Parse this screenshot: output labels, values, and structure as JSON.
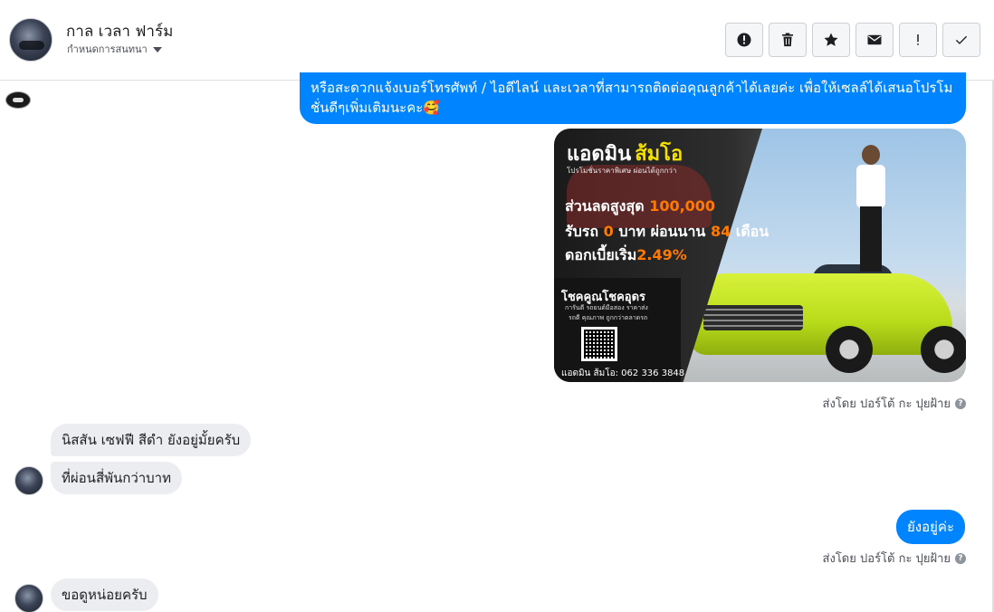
{
  "header": {
    "name": "กาล เวลา ฟาร์ม",
    "subtitle": "กำหนดการสนทนา"
  },
  "toolbar": {
    "buttons": [
      {
        "icon": "alert-circle-icon"
      },
      {
        "icon": "trash-icon"
      },
      {
        "icon": "star-icon"
      },
      {
        "icon": "envelope-icon"
      },
      {
        "icon": "exclamation-icon",
        "label": "!"
      },
      {
        "icon": "check-icon"
      }
    ]
  },
  "messages": {
    "long_outgoing": "หรือสะดวกแจ้งเบอร์โทรศัพท์ / ไอดีไลน์ และเวลาที่สามารถติดต่อคุณลูกค้าได้เลยค่ะ เพื่อให้เซลล์ได้เสนอโปรโมชั่นดีๆเพิ่มเติมนะคะ🥰",
    "ad": {
      "title_a": "แอดมิน",
      "title_b": "ส้มโอ",
      "tag": "โปรโมชั่นราคาพิเศษ ผ่อนได้ถูกกว่า",
      "line1_pre": "ส่วนลดสูงสุด ",
      "line1_hl": "100,000",
      "line2_pre": "รับรถ ",
      "line2_hl1": "0",
      "line2_mid": " บาท ผ่อนนาน ",
      "line2_hl2": "84",
      "line2_post": " เดือน",
      "line3_pre": "ดอกเบี้ยเริ่ม",
      "line3_hl": "2.49%",
      "brand": "โชคคูณโชคอุดร",
      "brand_sub1": "การันตี รถยนต์มือสอง ราคาส่ง",
      "brand_sub2": "รถดี คุณภาพ ถูกกว่าตลาดรถ",
      "contact": "แอดมิน ส้มโอ: 062 336 3848"
    },
    "sent_by_1": "ส่งโดย ปอร์โต้ กะ ปุยฝ้าย",
    "incoming_1": "นิสสัน เซฟฟี สีดำ ยังอยู่มั้ยครับ",
    "incoming_2": "ที่ผ่อนสี่พันกว่าบาท",
    "outgoing_short": "ยังอยู่ค่ะ",
    "sent_by_2": "ส่งโดย ปอร์โต้ กะ ปุยฝ้าย",
    "incoming_3": "ขอดูหน่อยครับ",
    "help_glyph": "?"
  },
  "colors": {
    "outgoing_bubble": "#0084ff",
    "incoming_bubble": "#ebedf0",
    "truck": "#c8e62a"
  }
}
